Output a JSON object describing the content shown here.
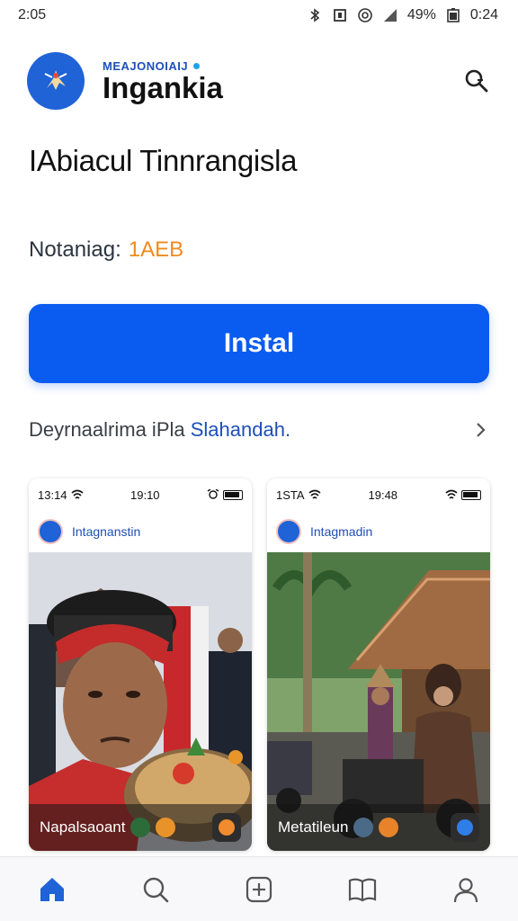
{
  "status_bar": {
    "time_left": "2:05",
    "battery": "49%",
    "time_right": "0:24",
    "icons": [
      "bluetooth-icon",
      "vibrate-icon",
      "wifi-icon",
      "signal-icon",
      "battery-icon"
    ]
  },
  "header": {
    "brand_top": "MEAJONOIAIJ",
    "brand_name": "Ingankia",
    "search_icon": "search-icon"
  },
  "app": {
    "title": "IAbiacul Tinnrangisla",
    "meta_label": "Notaniag:",
    "meta_value": "1AEB",
    "install_label": "Instal",
    "info_prefix": "Deyrnaalrima iPla",
    "info_link": "Slahandah."
  },
  "screenshots": [
    {
      "status_left": "13:14",
      "status_center": "19:10",
      "app_name": "Intagnanstin",
      "caption": "Napalsaoant"
    },
    {
      "status_left": "1STA",
      "status_center": "19:48",
      "app_name": "Intagmadin",
      "caption": "Metatileun"
    }
  ],
  "nav": {
    "items": [
      "home-icon",
      "search-icon",
      "add-icon",
      "library-icon",
      "profile-icon"
    ],
    "active": "home-icon"
  },
  "colors": {
    "accent": "#0a5cf0",
    "brand_blue": "#1f63d6",
    "meta_value": "#f08a1c",
    "link": "#1e4fb8"
  }
}
